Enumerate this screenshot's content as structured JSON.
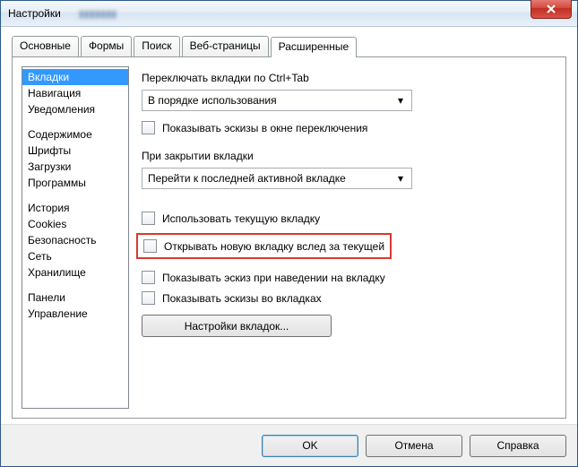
{
  "window": {
    "title": "Настройки"
  },
  "tabs": [
    "Основные",
    "Формы",
    "Поиск",
    "Веб-страницы",
    "Расширенные"
  ],
  "active_tab": 4,
  "side_groups": [
    [
      "Вкладки",
      "Навигация",
      "Уведомления"
    ],
    [
      "Содержимое",
      "Шрифты",
      "Загрузки",
      "Программы"
    ],
    [
      "История",
      "Cookies",
      "Безопасность",
      "Сеть",
      "Хранилище"
    ],
    [
      "Панели",
      "Управление"
    ]
  ],
  "side_selected": "Вкладки",
  "panel": {
    "switch_label": "Переключать вкладки по Ctrl+Tab",
    "switch_combo": "В порядке использования",
    "show_thumbs_switch": "Показывать эскизы в окне переключения",
    "close_label": "При закрытии вкладки",
    "close_combo": "Перейти к последней активной вкладке",
    "use_current": "Использовать текущую вкладку",
    "open_after_current": "Открывать новую вкладку вслед за текущей",
    "thumb_on_hover": "Показывать эскиз при наведении на вкладку",
    "thumbs_in_tabs": "Показывать эскизы во вкладках",
    "tab_settings_btn": "Настройки вкладок..."
  },
  "footer": {
    "ok": "OK",
    "cancel": "Отмена",
    "help": "Справка"
  }
}
